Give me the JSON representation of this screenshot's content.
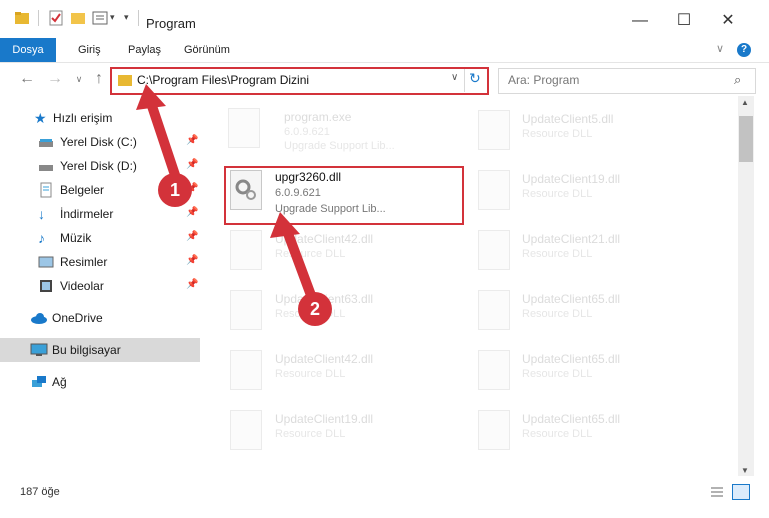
{
  "window": {
    "title": "Program",
    "minimize": "—",
    "maximize": "☐",
    "close": "✕"
  },
  "ribbon": {
    "tabs": [
      "Dosya",
      "Giriş",
      "Paylaş",
      "Görünüm"
    ]
  },
  "address": {
    "path": "C:\\Program Files\\Program Dizini"
  },
  "search": {
    "placeholder": "Ara: Program"
  },
  "nav": {
    "items": [
      {
        "label": "Hızlı erişim",
        "icon": "star-icon"
      },
      {
        "label": "Yerel Disk (C:)",
        "icon": "drive-icon",
        "pinned": true
      },
      {
        "label": "Yerel Disk (D:)",
        "icon": "drive-icon",
        "pinned": true
      },
      {
        "label": "Belgeler",
        "icon": "documents-icon",
        "pinned": true
      },
      {
        "label": "İndirmeler",
        "icon": "download-icon",
        "pinned": true
      },
      {
        "label": "Müzik",
        "icon": "music-icon",
        "pinned": true
      },
      {
        "label": "Resimler",
        "icon": "pictures-icon",
        "pinned": true
      },
      {
        "label": "Videolar",
        "icon": "video-icon",
        "pinned": true
      },
      {
        "label": "OneDrive",
        "icon": "cloud-icon"
      },
      {
        "label": "Bu bilgisayar",
        "icon": "computer-icon",
        "selected": true
      },
      {
        "label": "Ağ",
        "icon": "network-icon"
      }
    ]
  },
  "files": {
    "left": [
      {
        "name": "program.exe",
        "version": "6.0.9.621",
        "desc": "Upgrade Support Lib..."
      },
      {
        "name": "upgr3260.dll",
        "version": "6.0.9.621",
        "desc": "Upgrade Support Lib..."
      },
      {
        "name": "UpdateClient42.dll",
        "desc": "Resource DLL"
      },
      {
        "name": "UpdateClient63.dll",
        "desc": "Resource DLL"
      },
      {
        "name": "UpdateClient42.dll",
        "desc": "Resource DLL"
      },
      {
        "name": "UpdateClient19.dll",
        "desc": "Resource DLL"
      }
    ],
    "right": [
      {
        "name": "UpdateClient5.dll",
        "desc": "Resource DLL"
      },
      {
        "name": "UpdateClient19.dll",
        "desc": "Resource DLL"
      },
      {
        "name": "UpdateClient21.dll",
        "desc": "Resource DLL"
      },
      {
        "name": "UpdateClient65.dll",
        "desc": "Resource DLL"
      },
      {
        "name": "UpdateClient65.dll",
        "desc": "Resource DLL"
      },
      {
        "name": "UpdateClient65.dll",
        "desc": "Resource DLL"
      }
    ]
  },
  "annotations": {
    "step1": "1",
    "step2": "2"
  },
  "status": {
    "count": "187 öğe"
  },
  "colors": {
    "accent": "#1979ca",
    "highlight": "#d3323a"
  }
}
